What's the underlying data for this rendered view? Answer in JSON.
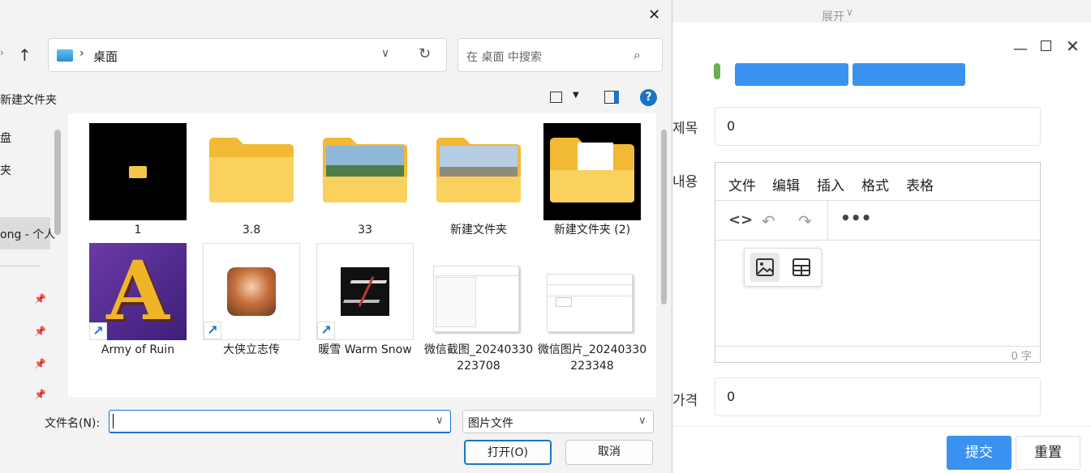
{
  "background_app": {
    "expand_label": "展开",
    "fields": {
      "title_label": "제목",
      "title_value": "0",
      "content_label": "내용",
      "price_label": "가격",
      "price_value": "0"
    },
    "editor": {
      "menu": [
        "文件",
        "编辑",
        "插入",
        "格式",
        "表格"
      ],
      "char_count": "0 字"
    },
    "buttons": {
      "submit": "提交",
      "reset": "重置"
    },
    "colors": {
      "accent": "#3a92f0"
    }
  },
  "dialog": {
    "breadcrumb": "桌面",
    "search_placeholder": "在 桌面 中搜索",
    "new_folder": "新建文件夹",
    "nav_items": [
      "盘",
      "夹",
      "ong - 个人"
    ],
    "files": [
      {
        "name": "1",
        "kind": "black-folder"
      },
      {
        "name": "3.8",
        "kind": "folder"
      },
      {
        "name": "33",
        "kind": "folder-photo"
      },
      {
        "name": "新建文件夹",
        "kind": "folder-photo"
      },
      {
        "name": "新建文件夹 (2)",
        "kind": "black-doc-folder"
      },
      {
        "name": "Army of Ruin",
        "kind": "shortcut"
      },
      {
        "name": "大侠立志传",
        "kind": "shortcut"
      },
      {
        "name": "暖雪 Warm Snow",
        "kind": "shortcut"
      },
      {
        "name": "微信截图_20240330223708",
        "kind": "image"
      },
      {
        "name": "微信图片_20240330223348",
        "kind": "image"
      }
    ],
    "filename_label": "文件名(N):",
    "filename_value": "",
    "filetype_value": "图片文件",
    "open_button": "打开(O)",
    "cancel_button": "取消"
  }
}
